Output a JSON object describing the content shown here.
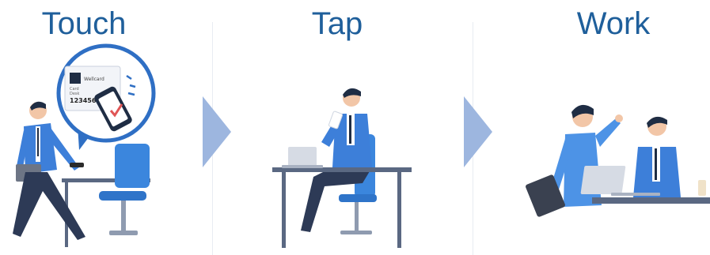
{
  "steps": [
    {
      "title": "Touch"
    },
    {
      "title": "Tap"
    },
    {
      "title": "Work"
    }
  ],
  "card": {
    "brand": "Wellcard",
    "line1": "Card",
    "line2": "Desk",
    "number": "123456"
  },
  "colors": {
    "title": "#1f5f9b",
    "arrow": "#9db6df",
    "jacket": "#3d7fd9",
    "pants": "#2d3a56",
    "chair": "#3b86dd"
  }
}
